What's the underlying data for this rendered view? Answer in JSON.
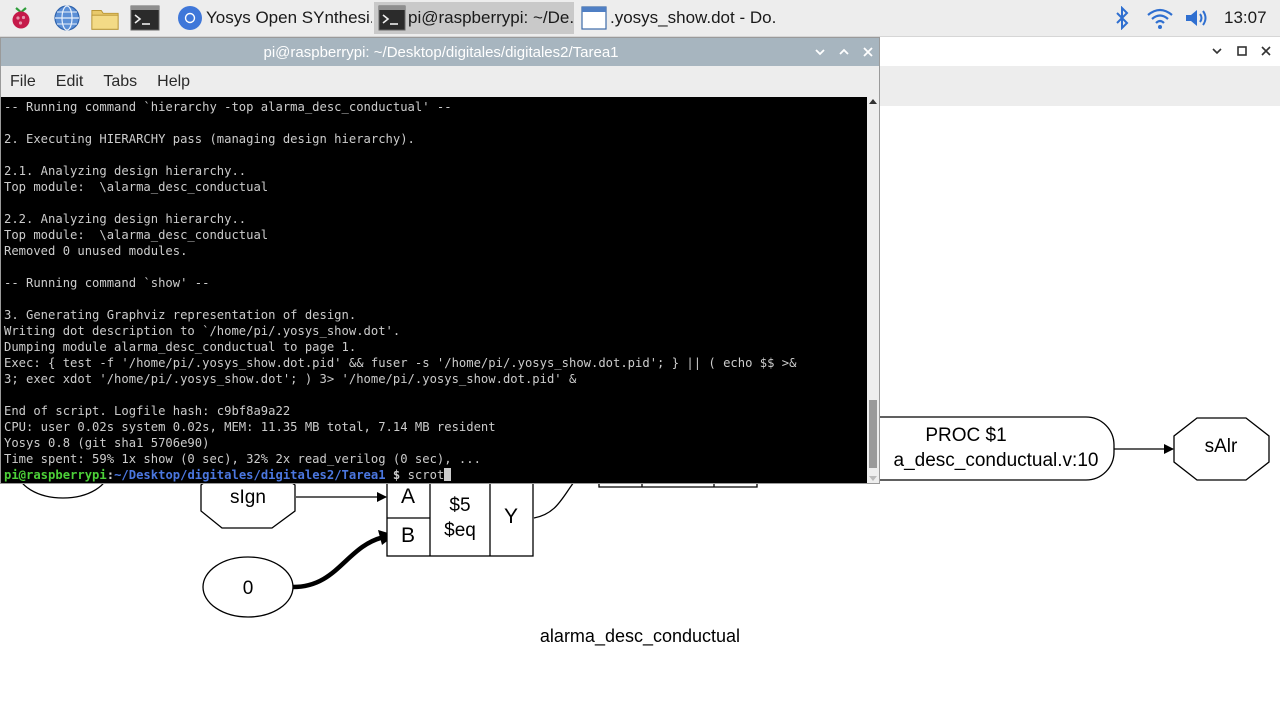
{
  "taskbar": {
    "launchers": [
      {
        "icon": "raspberry-icon"
      },
      {
        "icon": "globe-icon"
      },
      {
        "icon": "folder-icon"
      },
      {
        "icon": "terminal-icon"
      }
    ],
    "tasks": [
      {
        "label": "Yosys Open SYnthesi...",
        "icon": "chromium-icon"
      },
      {
        "label": "pi@raspberrypi: ~/De...",
        "icon": "terminal-icon",
        "active": true
      },
      {
        "label": ".yosys_show.dot - Do...",
        "icon": "window-icon"
      }
    ],
    "tray": [
      "bluetooth-icon",
      "wifi-icon",
      "volume-icon"
    ],
    "clock": "13:07"
  },
  "terminal": {
    "title": "pi@raspberrypi: ~/Desktop/digitales/digitales2/Tarea1",
    "menu": [
      "File",
      "Edit",
      "Tabs",
      "Help"
    ],
    "lines": [
      "-- Running command `hierarchy -top alarma_desc_conductual' --",
      "",
      "2. Executing HIERARCHY pass (managing design hierarchy).",
      "",
      "2.1. Analyzing design hierarchy..",
      "Top module:  \\alarma_desc_conductual",
      "",
      "2.2. Analyzing design hierarchy..",
      "Top module:  \\alarma_desc_conductual",
      "Removed 0 unused modules.",
      "",
      "-- Running command `show' --",
      "",
      "3. Generating Graphviz representation of design.",
      "Writing dot description to `/home/pi/.yosys_show.dot'.",
      "Dumping module alarma_desc_conductual to page 1.",
      "Exec: { test -f '/home/pi/.yosys_show.dot.pid' && fuser -s '/home/pi/.yosys_show.dot.pid'; } || ( echo $$ >&",
      "3; exec xdot '/home/pi/.yosys_show.dot'; ) 3> '/home/pi/.yosys_show.dot.pid' &",
      "",
      "End of script. Logfile hash: c9bf8a9a22",
      "CPU: user 0.02s system 0.02s, MEM: 11.35 MB total, 7.14 MB resident",
      "Yosys 0.8 (git sha1 5706e90)",
      "Time spent: 59% 1x show (0 sec), 32% 2x read_verilog (0 sec), ..."
    ],
    "prompt": {
      "user": "pi@raspberrypi",
      "colon": ":",
      "path": "~/Desktop/digitales/digitales2/Tarea1",
      "symbol": " $ ",
      "command": "scrot"
    }
  },
  "graph": {
    "proc_title": "PROC $1",
    "proc_sub": "a_desc_conductual.v:10",
    "output_port": "sAlr",
    "input_port": "sIgn",
    "const_node": "0",
    "cell_id": "$5",
    "cell_type": "$eq",
    "pin_a": "A",
    "pin_b": "B",
    "pin_y": "Y",
    "module_label": "alarma_desc_conductual"
  },
  "colors": {
    "title_bar": "#a7b5bf",
    "terminal_bg": "#000000",
    "prompt_user": "#4cd038",
    "prompt_path": "#4b77e0"
  }
}
